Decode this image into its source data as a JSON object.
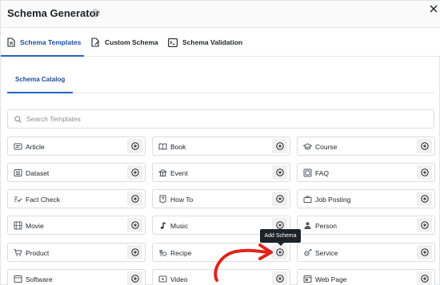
{
  "modal": {
    "title": "Schema Generator",
    "help_icon": "question-circle-icon",
    "close_icon": "close-icon"
  },
  "tabs": [
    {
      "label": "Schema Templates",
      "icon": "document-icon",
      "active": true
    },
    {
      "label": "Custom Schema",
      "icon": "edit-document-icon",
      "active": false
    },
    {
      "label": "Schema Validation",
      "icon": "terminal-icon",
      "active": false
    }
  ],
  "subtabs": [
    {
      "label": "Schema Catalog",
      "active": true
    }
  ],
  "search": {
    "placeholder": "Search Templates",
    "value": ""
  },
  "templates": [
    {
      "label": "Article",
      "icon": "article-icon"
    },
    {
      "label": "Book",
      "icon": "book-icon"
    },
    {
      "label": "Course",
      "icon": "graduation-cap-icon"
    },
    {
      "label": "Dataset",
      "icon": "dataset-icon"
    },
    {
      "label": "Event",
      "icon": "event-icon"
    },
    {
      "label": "FAQ",
      "icon": "faq-icon"
    },
    {
      "label": "Fact Check",
      "icon": "fact-check-icon"
    },
    {
      "label": "How To",
      "icon": "how-to-icon"
    },
    {
      "label": "Job Posting",
      "icon": "briefcase-icon"
    },
    {
      "label": "Movie",
      "icon": "movie-icon"
    },
    {
      "label": "Music",
      "icon": "music-note-icon"
    },
    {
      "label": "Person",
      "icon": "person-icon"
    },
    {
      "label": "Product",
      "icon": "cart-icon"
    },
    {
      "label": "Recipe",
      "icon": "recipe-icon"
    },
    {
      "label": "Service",
      "icon": "service-icon"
    },
    {
      "label": "Software",
      "icon": "software-icon"
    },
    {
      "label": "Video",
      "icon": "video-icon"
    },
    {
      "label": "Web Page",
      "icon": "web-page-icon"
    }
  ],
  "add_icon": "add-circle-icon",
  "tooltip": {
    "text": "Add Schema"
  },
  "colors": {
    "accent": "#2563c9",
    "active_tab_text": "#1a4fa0",
    "tooltip_bg": "#1d2327",
    "annotation_arrow": "#e0241b"
  }
}
